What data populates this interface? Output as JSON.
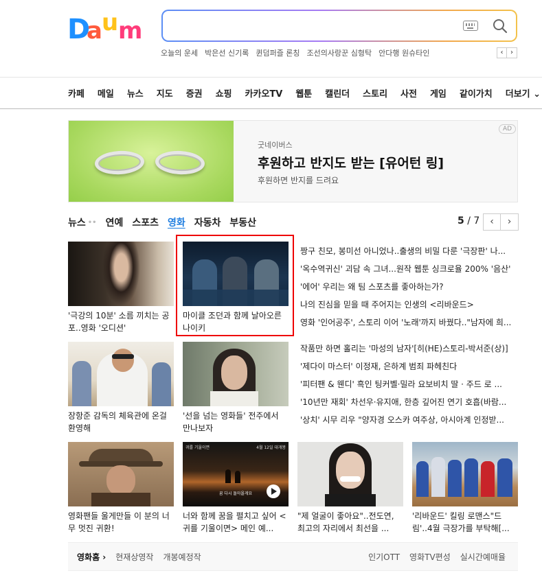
{
  "header": {
    "logo_text": "Daum",
    "search_placeholder": "",
    "trending": [
      "오늘의 운세",
      "박은선 신기록",
      "퀸덤퍼즐 론칭",
      "조선의사랑꾼 심형탁",
      "안다행 원슈타인"
    ],
    "trend_prev": "‹",
    "trend_next": "›"
  },
  "gnb": [
    "카페",
    "메일",
    "뉴스",
    "지도",
    "증권",
    "쇼핑",
    "카카오TV",
    "웹툰",
    "캘린더",
    "스토리",
    "사전",
    "게임",
    "같이가치",
    "더보기 ⌄"
  ],
  "ad": {
    "brand": "굿네이버스",
    "title": "후원하고 반지도 받는 [유어턴 링]",
    "subtitle": "후원하면 반지를 드려요",
    "badge": "AD"
  },
  "tabs": {
    "items": [
      "뉴스",
      "연예",
      "스포츠",
      "영화",
      "자동차",
      "부동산"
    ],
    "dots": "••",
    "active_index": 3,
    "page_current": "5",
    "page_total": "/ 7",
    "prev": "‹",
    "next": "›"
  },
  "cards": [
    {
      "caption": "'극강의 10분' 소름 끼치는 공포..영화 '오디션'"
    },
    {
      "caption": "마이클 조던과 함께 날아오른 나이키"
    },
    {
      "caption": "장항준 감독의 체육관에 온걸 환영해"
    },
    {
      "caption": "'선을 넘는 영화들' 전주에서 만나보자"
    },
    {
      "caption": "영화팬들 울게만들 이 분의 너무 멋진 귀환!"
    },
    {
      "caption": "너와 함께 꿈을 펼치고 싶어 <귀를 기울이면> 메인 예..."
    },
    {
      "caption": "\"제 얼굴이 좋아요\"..전도연, 최고의 자리에서 최선을 ..."
    },
    {
      "caption": "'리바운드' 킬링 로맨스\"드림'..4월 극장가를 부탁해[..."
    }
  ],
  "thumb_texts": {
    "card6_top_left": "귀를 기울이면",
    "card6_top_right": "4월 12일 대개봉",
    "card6_center": "꿈 다시 돌아올게요"
  },
  "headlines_top": [
    "짱구 친모, 봉미선 아니었나..출생의 비밀 다룬 '극장판' 나...",
    "'옥수역귀신' 괴담 속 그녀...원작 웹툰 싱크로율 200% '음산'",
    "'에어' 우리는 왜 팀 스포츠를 좋아하는가?",
    "나의 진심을 믿을 때 주어지는 인생의 <리바운드>",
    "영화 '인어공주', 스토리 이어 '노래'까지 바꿨다..\"남자에 희..."
  ],
  "headlines_mid": [
    "작품만 하면 홀리는 '마성의 남자'[히(HE)스토리-박서준(상)]",
    "'제다이 마스터' 이정재, 은하계 범죄 파헤친다",
    "'피터팬 & 웬디' 흑인 팅커벨·밀라 요보비치 딸 · 주드 로 ...",
    "'10년만 재회' 차선우·유지애, 한층 깊어진 연기 호흡(바람...",
    "'상치' 시무 리우 \"양자경 오스카 여주상, 아시아계 인정받..."
  ],
  "footer": {
    "home": "영화홈 ›",
    "left_links": [
      "현재상영작",
      "개봉예정작"
    ],
    "right_links": [
      "인기OTT",
      "영화TV편성",
      "실시간예매율"
    ]
  },
  "colors": {
    "logo_d": "#1e90ff",
    "logo_a": "#ff5a3c",
    "logo_u": "#ffc21a",
    "logo_m": "#ff3c7a",
    "active_tab": "#1e7de0",
    "highlight": "#e00000"
  }
}
